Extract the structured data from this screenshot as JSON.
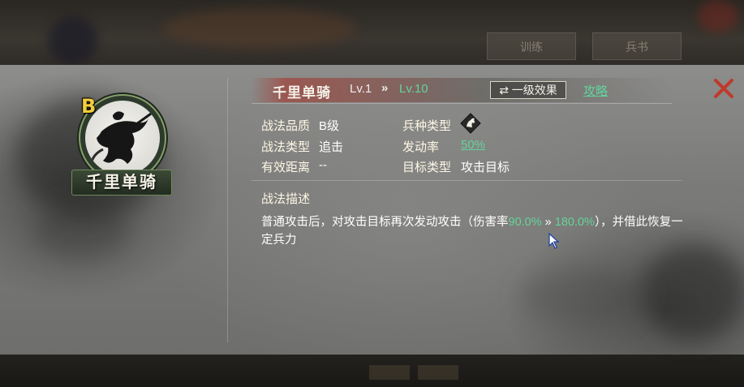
{
  "background": {
    "top_buttons": [
      "训练",
      "兵书"
    ],
    "bottom_labels": [
      "",
      ""
    ]
  },
  "skill": {
    "grade": "B",
    "name": "千里单骑",
    "level_current": "Lv.1",
    "level_arrow": "»",
    "level_max": "Lv.10",
    "effect_button": "⇄ 一级效果",
    "strategy_link": "攻略",
    "close_icon": "close-x-icon"
  },
  "info": {
    "quality_label": "战法品质",
    "quality_value": "B级",
    "unit_type_label": "兵种类型",
    "unit_type_icon": "cavalry-horse-icon",
    "type_label": "战法类型",
    "type_value": "追击",
    "trigger_label": "发动率",
    "trigger_value": "50%",
    "range_label": "有效距离",
    "range_value": "--",
    "target_label": "目标类型",
    "target_value": "攻击目标"
  },
  "description": {
    "title": "战法描述",
    "part1": "普通攻击后，对攻击目标再次发动攻击（伤害率",
    "rate_low": "90.0%",
    "arrow": " » ",
    "rate_high": "180.0%",
    "part2": "），并借此恢复一定兵力"
  },
  "colors": {
    "accent_green": "#63d49a",
    "close_red": "#c0392b",
    "grade_yellow": "#f2cd3c"
  }
}
